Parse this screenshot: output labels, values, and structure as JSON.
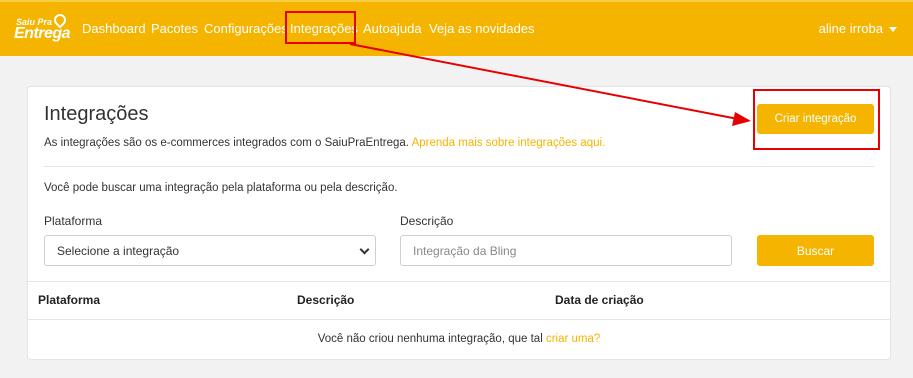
{
  "brand": {
    "line1": "Saiu Pra",
    "line2": "Entrega"
  },
  "nav": {
    "items": [
      "Dashboard",
      "Pacotes",
      "Configurações",
      "Integrações",
      "Autoajuda",
      "Veja as novidades"
    ],
    "user": "aline irroba"
  },
  "page": {
    "title": "Integrações",
    "subtitle": "As integrações são os e-commerces integrados com o SaiuPraEntrega.",
    "subtitle_link": "Aprenda mais sobre integrações aqui.",
    "create_button": "Criar integração",
    "hint": "Você pode buscar uma integração pela plataforma ou pela descrição."
  },
  "filters": {
    "platform_label": "Plataforma",
    "platform_value": "Selecione a integração",
    "description_label": "Descrição",
    "description_placeholder": "Integração da Bling",
    "search_button": "Buscar"
  },
  "table": {
    "headers": [
      "Plataforma",
      "Descrição",
      "Data de criação"
    ],
    "empty_text": "Você não criou nenhuma integração, que tal",
    "empty_link": "criar uma?"
  },
  "colors": {
    "brand": "#f4b400",
    "annotation": "#e60000"
  },
  "icons": {
    "logo": "map-pin-icon",
    "user_menu": "caret-down-icon",
    "select": "chevron-down-icon"
  }
}
